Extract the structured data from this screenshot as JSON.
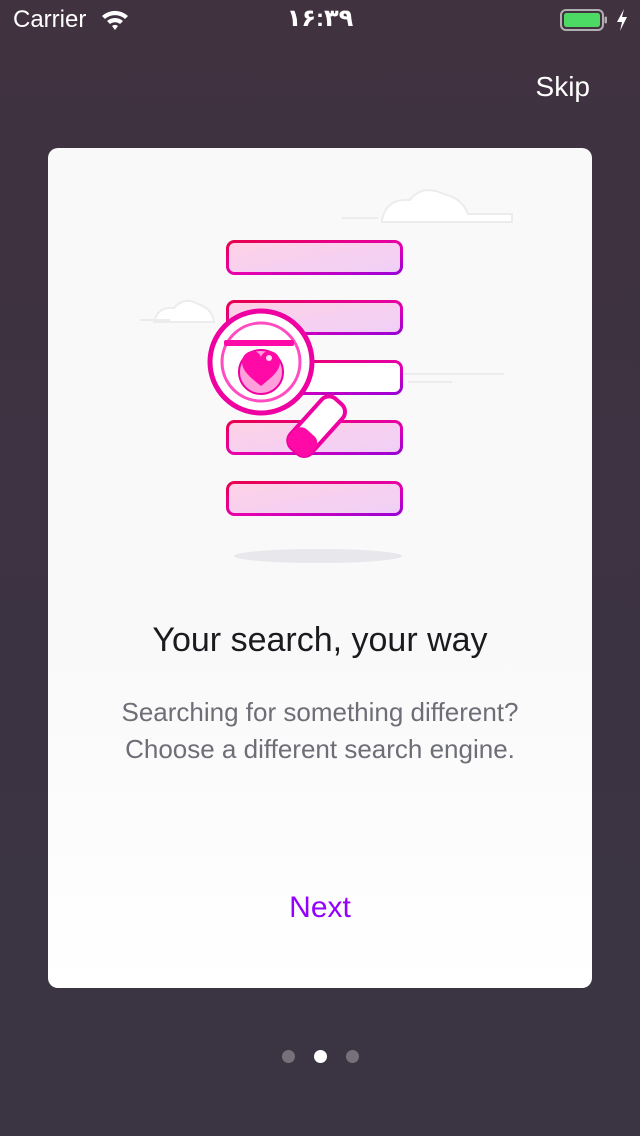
{
  "status_bar": {
    "carrier": "Carrier",
    "time": "۱۶:۳۹",
    "wifi_icon": "wifi-icon",
    "battery_icon": "battery-icon",
    "battery_color": "#4cd964",
    "charging_icon": "charging-bolt-icon"
  },
  "onboarding": {
    "skip_label": "Skip",
    "card": {
      "illustration": "search-list-magnifier-heart-illustration",
      "title": "Your search, your way",
      "description": "Searching for something different? Choose a different search engine.",
      "next_label": "Next"
    },
    "pager": {
      "total_pages": 3,
      "current_page": 2
    }
  },
  "colors": {
    "background": "#3d3342",
    "accent": "#9400ff",
    "illustration_pink": "#ff00a8",
    "title_text": "#1b1b1f",
    "body_text": "#6e6e77"
  }
}
